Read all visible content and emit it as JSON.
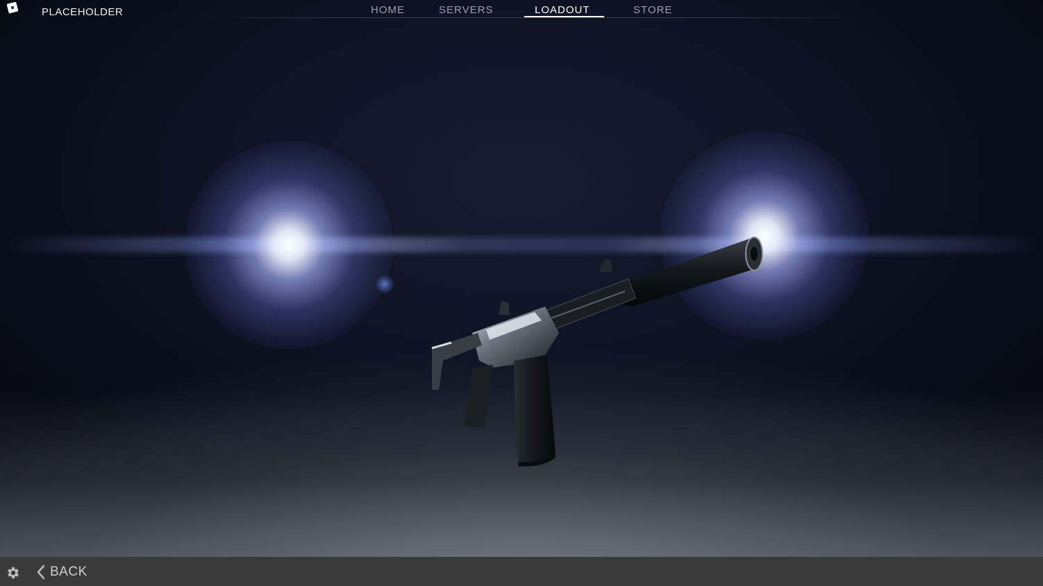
{
  "header": {
    "game_title": "PLACEHOLDER",
    "app_icon": "roblox-icon"
  },
  "nav": {
    "tabs": [
      {
        "label": "HOME",
        "active": false
      },
      {
        "label": "SERVERS",
        "active": false
      },
      {
        "label": "LOADOUT",
        "active": true
      },
      {
        "label": "STORE",
        "active": false
      }
    ]
  },
  "footer": {
    "settings_icon": "gear-icon",
    "back_icon": "chevron-left-icon",
    "back_label": "BACK"
  },
  "colors": {
    "footer_bg": "#3a3a3a",
    "active_tab": "#ffffff",
    "inactive_tab": "#9aa1ad"
  }
}
